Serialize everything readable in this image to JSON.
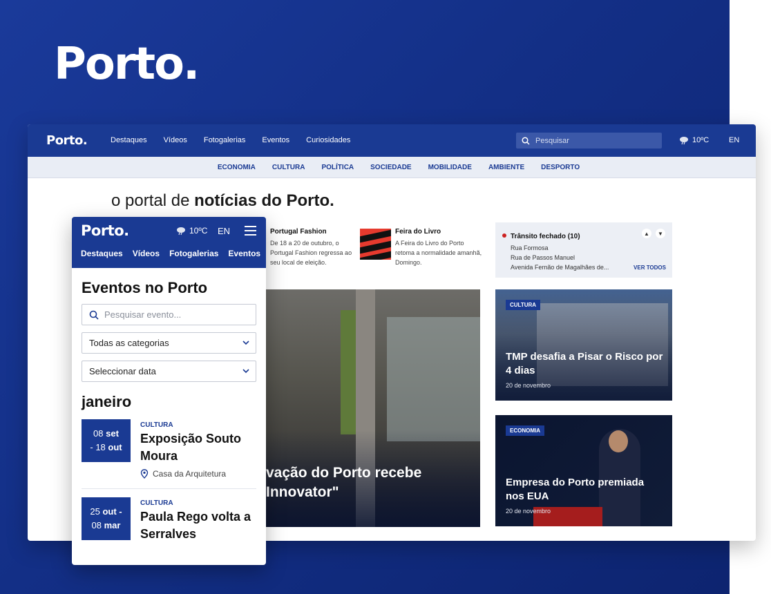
{
  "brand": {
    "logo": "Porto."
  },
  "desktop": {
    "nav": {
      "logo": "Porto.",
      "items": [
        "Destaques",
        "Vídeos",
        "Fotogalerias",
        "Eventos",
        "Curiosidades"
      ],
      "search_placeholder": "Pesquisar",
      "temperature": "10ºC",
      "lang": "EN"
    },
    "categories": [
      "ECONOMIA",
      "CULTURA",
      "POLÍTICA",
      "SOCIEDADE",
      "MOBILIDADE",
      "AMBIENTE",
      "DESPORTO"
    ],
    "tagline_normal": "o portal de ",
    "tagline_bold": "notícias do Porto.",
    "news": [
      {
        "title": "Portugal Fashion",
        "desc": "De 18 a 20 de outubro, o Portugal Fashion regressa ao seu local de eleição."
      },
      {
        "title": "Feira do Livro",
        "desc": "A Feira do Livro do Porto retoma a normalidade amanhã, Domingo."
      }
    ],
    "traffic": {
      "title": "Trânsito fechado (10)",
      "items": [
        "Rua Formosa",
        "Rua de Passos Manuel",
        "Avenida Fernão de Magalhães de..."
      ],
      "link": "VER TODOS"
    },
    "hero": {
      "title_line1": "vação do Porto recebe",
      "title_line2": " Innovator\""
    },
    "cards": [
      {
        "badge": "CULTURA",
        "title": "TMP desafia a Pisar o Risco por 4 dias",
        "date": "20 de novembro"
      },
      {
        "badge": "ECONOMIA",
        "title": "Empresa do Porto premiada nos EUA",
        "date": "20 de novembro"
      }
    ]
  },
  "mobile": {
    "nav": {
      "logo": "Porto.",
      "temperature": "10ºC",
      "lang": "EN",
      "items": [
        "Destaques",
        "Vídeos",
        "Fotogalerias",
        "Eventos"
      ]
    },
    "heading": "Eventos no Porto",
    "search_placeholder": "Pesquisar evento...",
    "category_select": "Todas as categorias",
    "date_select": "Seleccionar data",
    "month": "janeiro",
    "events": [
      {
        "date_line1_num": "08",
        "date_line1_mon": "set",
        "date_line2_num": "- 18",
        "date_line2_mon": "out",
        "category": "CULTURA",
        "title": "Exposição Souto Moura",
        "location": "Casa da Arquitetura"
      },
      {
        "date_line1_num": "25",
        "date_line1_mon": "out -",
        "date_line2_num": "08",
        "date_line2_mon": "mar",
        "category": "CULTURA",
        "title": "Paula Rego volta a Serralves"
      }
    ]
  },
  "colors": {
    "brand_blue": "#1a3a93",
    "traffic_red": "#cc2222"
  }
}
